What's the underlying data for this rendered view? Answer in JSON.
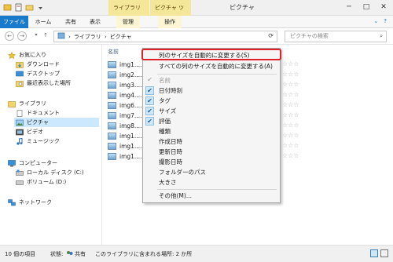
{
  "window": {
    "title": "ピクチャ",
    "context_tabs": [
      "ライブラリ ツール",
      "ピクチャ ツール"
    ],
    "controls": [
      "─",
      "□",
      "✕"
    ]
  },
  "ribbon": {
    "tabs": [
      "ファイル",
      "ホーム",
      "共有",
      "表示",
      "管理",
      "操作"
    ]
  },
  "address": {
    "path": [
      "ライブラリ",
      "ピクチャ"
    ],
    "search_placeholder": "ピクチャの検索"
  },
  "nav": {
    "favorites": "お気に入り",
    "downloads": "ダウンロード",
    "desktop": "デスクトップ",
    "recent": "最近表示した場所",
    "library": "ライブラリ",
    "documents": "ドキュメント",
    "pictures": "ピクチャ",
    "videos": "ビデオ",
    "music": "ミュージック",
    "computer": "コンピューター",
    "local_disk": "ローカル ディスク (C:)",
    "volume_d": "ボリューム (D:)",
    "network": "ネットワーク"
  },
  "content": {
    "column_name": "名前",
    "files": [
      "img1....",
      "img2....",
      "img3....",
      "img4....",
      "img6....",
      "img7....",
      "img8....",
      "img1....",
      "img1....",
      "img1...."
    ],
    "stars": "☆☆☆"
  },
  "context_menu": {
    "items": [
      {
        "label": "列のサイズを自動的に変更する(S)",
        "checked": false,
        "highlighted": true
      },
      {
        "label": "すべての列のサイズを自動的に変更する(A)",
        "checked": false
      },
      {
        "label": "名前",
        "checked": true,
        "disabled": true
      },
      {
        "label": "日付時刻",
        "checked": true
      },
      {
        "label": "タグ",
        "checked": true
      },
      {
        "label": "サイズ",
        "checked": true
      },
      {
        "label": "評価",
        "checked": true
      },
      {
        "label": "種類",
        "checked": false
      },
      {
        "label": "作成日時",
        "checked": false
      },
      {
        "label": "更新日時",
        "checked": false
      },
      {
        "label": "撮影日時",
        "checked": false
      },
      {
        "label": "フォルダーのパス",
        "checked": false
      },
      {
        "label": "大きさ",
        "checked": false
      },
      {
        "label": "その他(M)...",
        "checked": false
      }
    ],
    "highlight_color": "#e0202a"
  },
  "status": {
    "count": "10 個の項目",
    "state_label": "状態:",
    "state_value": "共有",
    "location": "このライブラリに含まれる場所: 2 か所"
  }
}
